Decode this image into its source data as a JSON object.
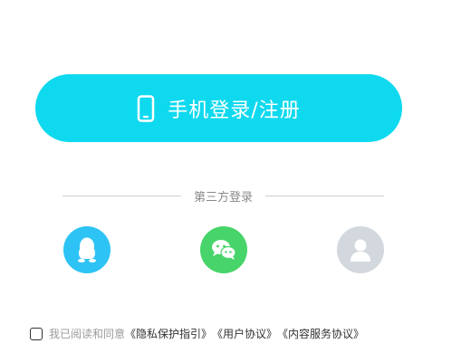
{
  "colors": {
    "primary": "#0fd9ef",
    "qq": "#2ec3f5",
    "wechat": "#47d46a",
    "account": "#d3d7de"
  },
  "login": {
    "phone_button_label": "手机登录/注册",
    "phone_icon": "phone-icon"
  },
  "third_party": {
    "title": "第三方登录",
    "options": [
      {
        "name": "QQ",
        "icon": "qq-icon"
      },
      {
        "name": "WeChat",
        "icon": "wechat-icon"
      },
      {
        "name": "Account",
        "icon": "user-icon"
      }
    ]
  },
  "agreement": {
    "prefix": "我已阅读和同意",
    "privacy": "《隐私保护指引》",
    "user": "《用户协议》",
    "content": "《内容服务协议》"
  }
}
